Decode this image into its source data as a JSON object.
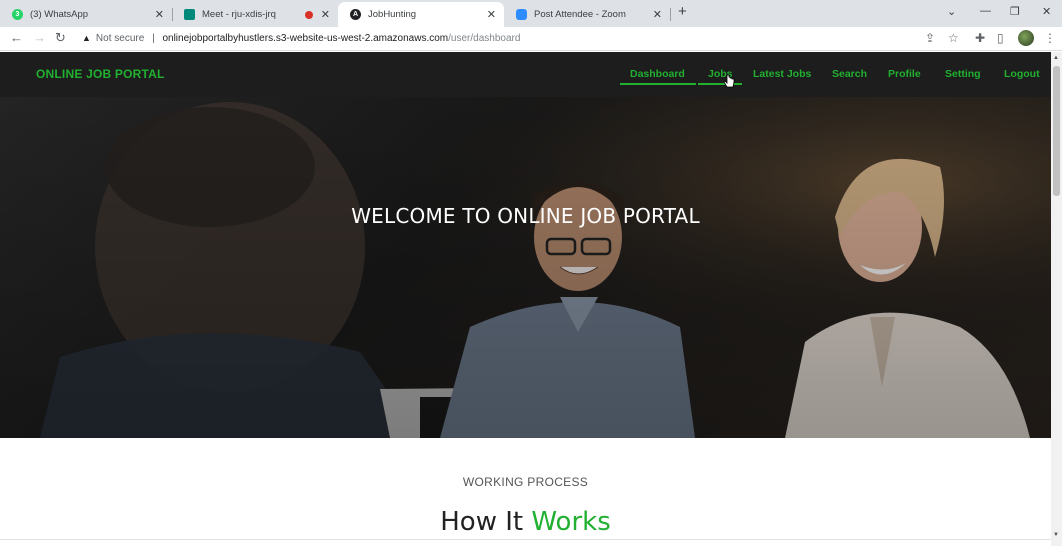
{
  "browser": {
    "tabs": [
      {
        "title": "(3) WhatsApp",
        "favicon": "whatsapp-icon",
        "color": "#25d366",
        "badge": "3"
      },
      {
        "title": "Meet - rju-xdis-jrq",
        "favicon": "meet-icon",
        "color": "#00897b"
      },
      {
        "title": "JobHunting",
        "favicon": "angular-icon",
        "color": "#202124"
      },
      {
        "title": "Post Attendee - Zoom",
        "favicon": "zoom-icon",
        "color": "#2d8cff"
      }
    ],
    "new_tab": "+",
    "security_label": "Not secure",
    "url_host": "onlinejobportalbyhustlers.s3-website-us-west-2.amazonaws.com",
    "url_path": "/user/dashboard"
  },
  "site": {
    "brand": "ONLINE JOB PORTAL",
    "nav": [
      {
        "label": "Dashboard"
      },
      {
        "label": "Jobs"
      },
      {
        "label": "Latest Jobs"
      },
      {
        "label": "Search"
      },
      {
        "label": "Profile"
      },
      {
        "label": "Setting"
      },
      {
        "label": "Logout"
      }
    ],
    "accent_color": "#21b030",
    "hero_title": "WELCOME TO ONLINE JOB PORTAL",
    "section_kicker": "WORKING PROCESS",
    "section_title_lead": "How It",
    "section_title_accent": "Works"
  }
}
